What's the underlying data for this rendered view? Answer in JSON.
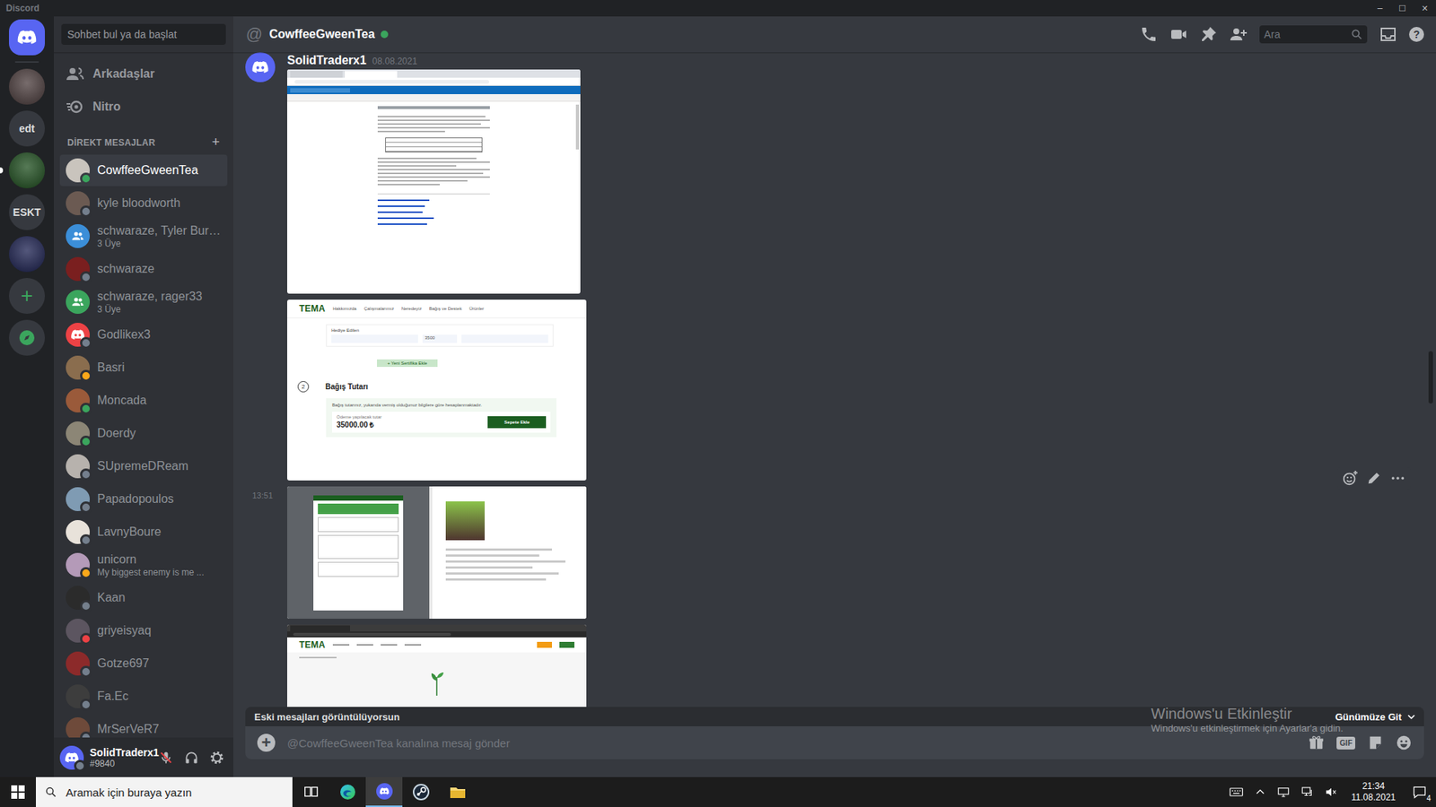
{
  "window": {
    "title": "Discord",
    "controls": [
      "─",
      "☐",
      "✕"
    ]
  },
  "servers": [
    {
      "kind": "home",
      "color": "#5865f2",
      "selected": true,
      "unread": false
    },
    {
      "kind": "image",
      "color": "#4a3b3b",
      "selected": false,
      "unread": false
    },
    {
      "kind": "text",
      "label": "edt",
      "color": "#36393f",
      "selected": false,
      "unread": false
    },
    {
      "kind": "image",
      "color": "#1d4d1d",
      "selected": false,
      "unread": true
    },
    {
      "kind": "text",
      "label": "ESKT",
      "color": "#36393f",
      "selected": false,
      "unread": false
    },
    {
      "kind": "image",
      "color": "#1a1f4f",
      "selected": false,
      "unread": false
    },
    {
      "kind": "add",
      "label": "+",
      "color": "#36393f",
      "selected": false,
      "unread": false
    },
    {
      "kind": "explore",
      "color": "#36393f",
      "selected": false,
      "unread": false
    }
  ],
  "sidebar": {
    "search_placeholder": "Sohbet bul ya da başlat",
    "nav": [
      {
        "kind": "friends",
        "label": "Arkadaşlar"
      },
      {
        "kind": "nitro",
        "label": "Nitro"
      }
    ],
    "dm_title": "DİREKT MESAJLAR",
    "dm_add": "+",
    "dms": [
      {
        "name": "CowffeeGweenTea",
        "kind": "user",
        "selected": true,
        "color": "#3ba55d",
        "avatar_color": "#c9c4bd"
      },
      {
        "name": "kyle bloodworth",
        "kind": "user",
        "selected": false,
        "color": "#747f8d",
        "avatar_color": "#6b5a52"
      },
      {
        "name": "schwaraze, Tyler Bur…",
        "subtitle": "3 Üye",
        "kind": "group",
        "selected": false,
        "avatar_color": "#3b8ed8"
      },
      {
        "name": "schwaraze",
        "kind": "user",
        "selected": false,
        "color": "#747f8d",
        "avatar_color": "#7a1f1f"
      },
      {
        "name": "schwaraze, rager33",
        "subtitle": "3 Üye",
        "kind": "group",
        "selected": false,
        "avatar_color": "#3ba55d"
      },
      {
        "name": "Godlikex3",
        "kind": "default",
        "selected": false,
        "color": "#747f8d",
        "avatar_color": "#ed4245"
      },
      {
        "name": "Basri",
        "kind": "user",
        "selected": false,
        "color": "#faa81a",
        "avatar_color": "#8a6d4e"
      },
      {
        "name": "Moncada",
        "kind": "user",
        "selected": false,
        "color": "#3ba55d",
        "avatar_color": "#9a5a3a"
      },
      {
        "name": "Doerdy",
        "kind": "user",
        "selected": false,
        "color": "#3ba55d",
        "avatar_color": "#8c8676"
      },
      {
        "name": "SUpremeDReam",
        "kind": "user",
        "selected": false,
        "color": "#747f8d",
        "avatar_color": "#b7b2ad"
      },
      {
        "name": "Papadopoulos",
        "kind": "user",
        "selected": false,
        "color": "#747f8d",
        "avatar_color": "#7f9bb3"
      },
      {
        "name": "LavnyBoure",
        "kind": "user",
        "selected": false,
        "color": "#747f8d",
        "avatar_color": "#e8e2da"
      },
      {
        "name": "unicorn",
        "subtitle": "My biggest enemy is me ...",
        "kind": "user",
        "selected": false,
        "color": "#faa81a",
        "avatar_color": "#b49ab8"
      },
      {
        "name": "Kaan",
        "kind": "user",
        "selected": false,
        "color": "#747f8d",
        "avatar_color": "#2b2b2b"
      },
      {
        "name": "griyeisyaq",
        "kind": "user",
        "selected": false,
        "color": "#ed4245",
        "avatar_color": "#5c5560"
      },
      {
        "name": "Gotze697",
        "kind": "user",
        "selected": false,
        "color": "#747f8d",
        "avatar_color": "#8c2a2a"
      },
      {
        "name": "Fa.Ec",
        "kind": "user",
        "selected": false,
        "color": "#747f8d",
        "avatar_color": "#3d3d3d"
      },
      {
        "name": "MrSerVeR7",
        "kind": "user",
        "selected": false,
        "color": "#747f8d",
        "avatar_color": "#6e4a3a"
      }
    ]
  },
  "user_panel": {
    "name": "SolidTraderx1",
    "tag": "#9840",
    "avatar_color": "#5865f2",
    "status_color": "#747f8d",
    "mic_muted": true
  },
  "channel": {
    "prefix": "@",
    "name": "CowffeeGweenTea",
    "online": true,
    "search_placeholder": "Ara",
    "help": "?"
  },
  "message": {
    "author": "SolidTraderx1",
    "date": "08.08.2021",
    "avatar_color": "#5865f2",
    "attachments": [
      {
        "kind": "email"
      },
      {
        "kind": "donation",
        "logo": "TEMA",
        "nav": [
          "Hakkımızda",
          "Çalışmalarımız",
          "Neredeyiz",
          "Bağış ve Destek",
          "Ürünler"
        ],
        "section": "Hediye Edilen",
        "field_value": "3500",
        "add_button": "+ Yeni Sertifika Ekle",
        "step": "2",
        "title": "Bağış Tutarı",
        "note": "Bağış tutarınız, yukarıda vermiş olduğunuz bilgilere göre hesaplanmaktadır.",
        "amount_label": "Ödeme yapılacak tutar",
        "amount": "35000.00 ₺",
        "button": "Sepete Ekle"
      },
      {
        "kind": "payment",
        "time": "13:51"
      },
      {
        "kind": "page",
        "logo": "TEMA"
      }
    ]
  },
  "composer": {
    "old_messages": "Eski mesajları görüntülüyorsun",
    "jump": "Günümüze Git",
    "add": "+",
    "placeholder": "@CowffeeGweenTea kanalına mesaj gönder",
    "gif": "GIF"
  },
  "watermark": {
    "title": "Windows'u Etkinleştir",
    "text": "Windows'u etkinleştirmek için Ayarlar'a gidin."
  },
  "taskbar": {
    "search_placeholder": "Aramak için buraya yazın",
    "time": "21:34",
    "date": "11.08.2021",
    "notifications": "4",
    "apps": [
      {
        "kind": "taskview",
        "active": false
      },
      {
        "kind": "edge",
        "active": false
      },
      {
        "kind": "discord",
        "active": true
      },
      {
        "kind": "steam",
        "active": false
      },
      {
        "kind": "explorer",
        "active": false
      }
    ]
  }
}
